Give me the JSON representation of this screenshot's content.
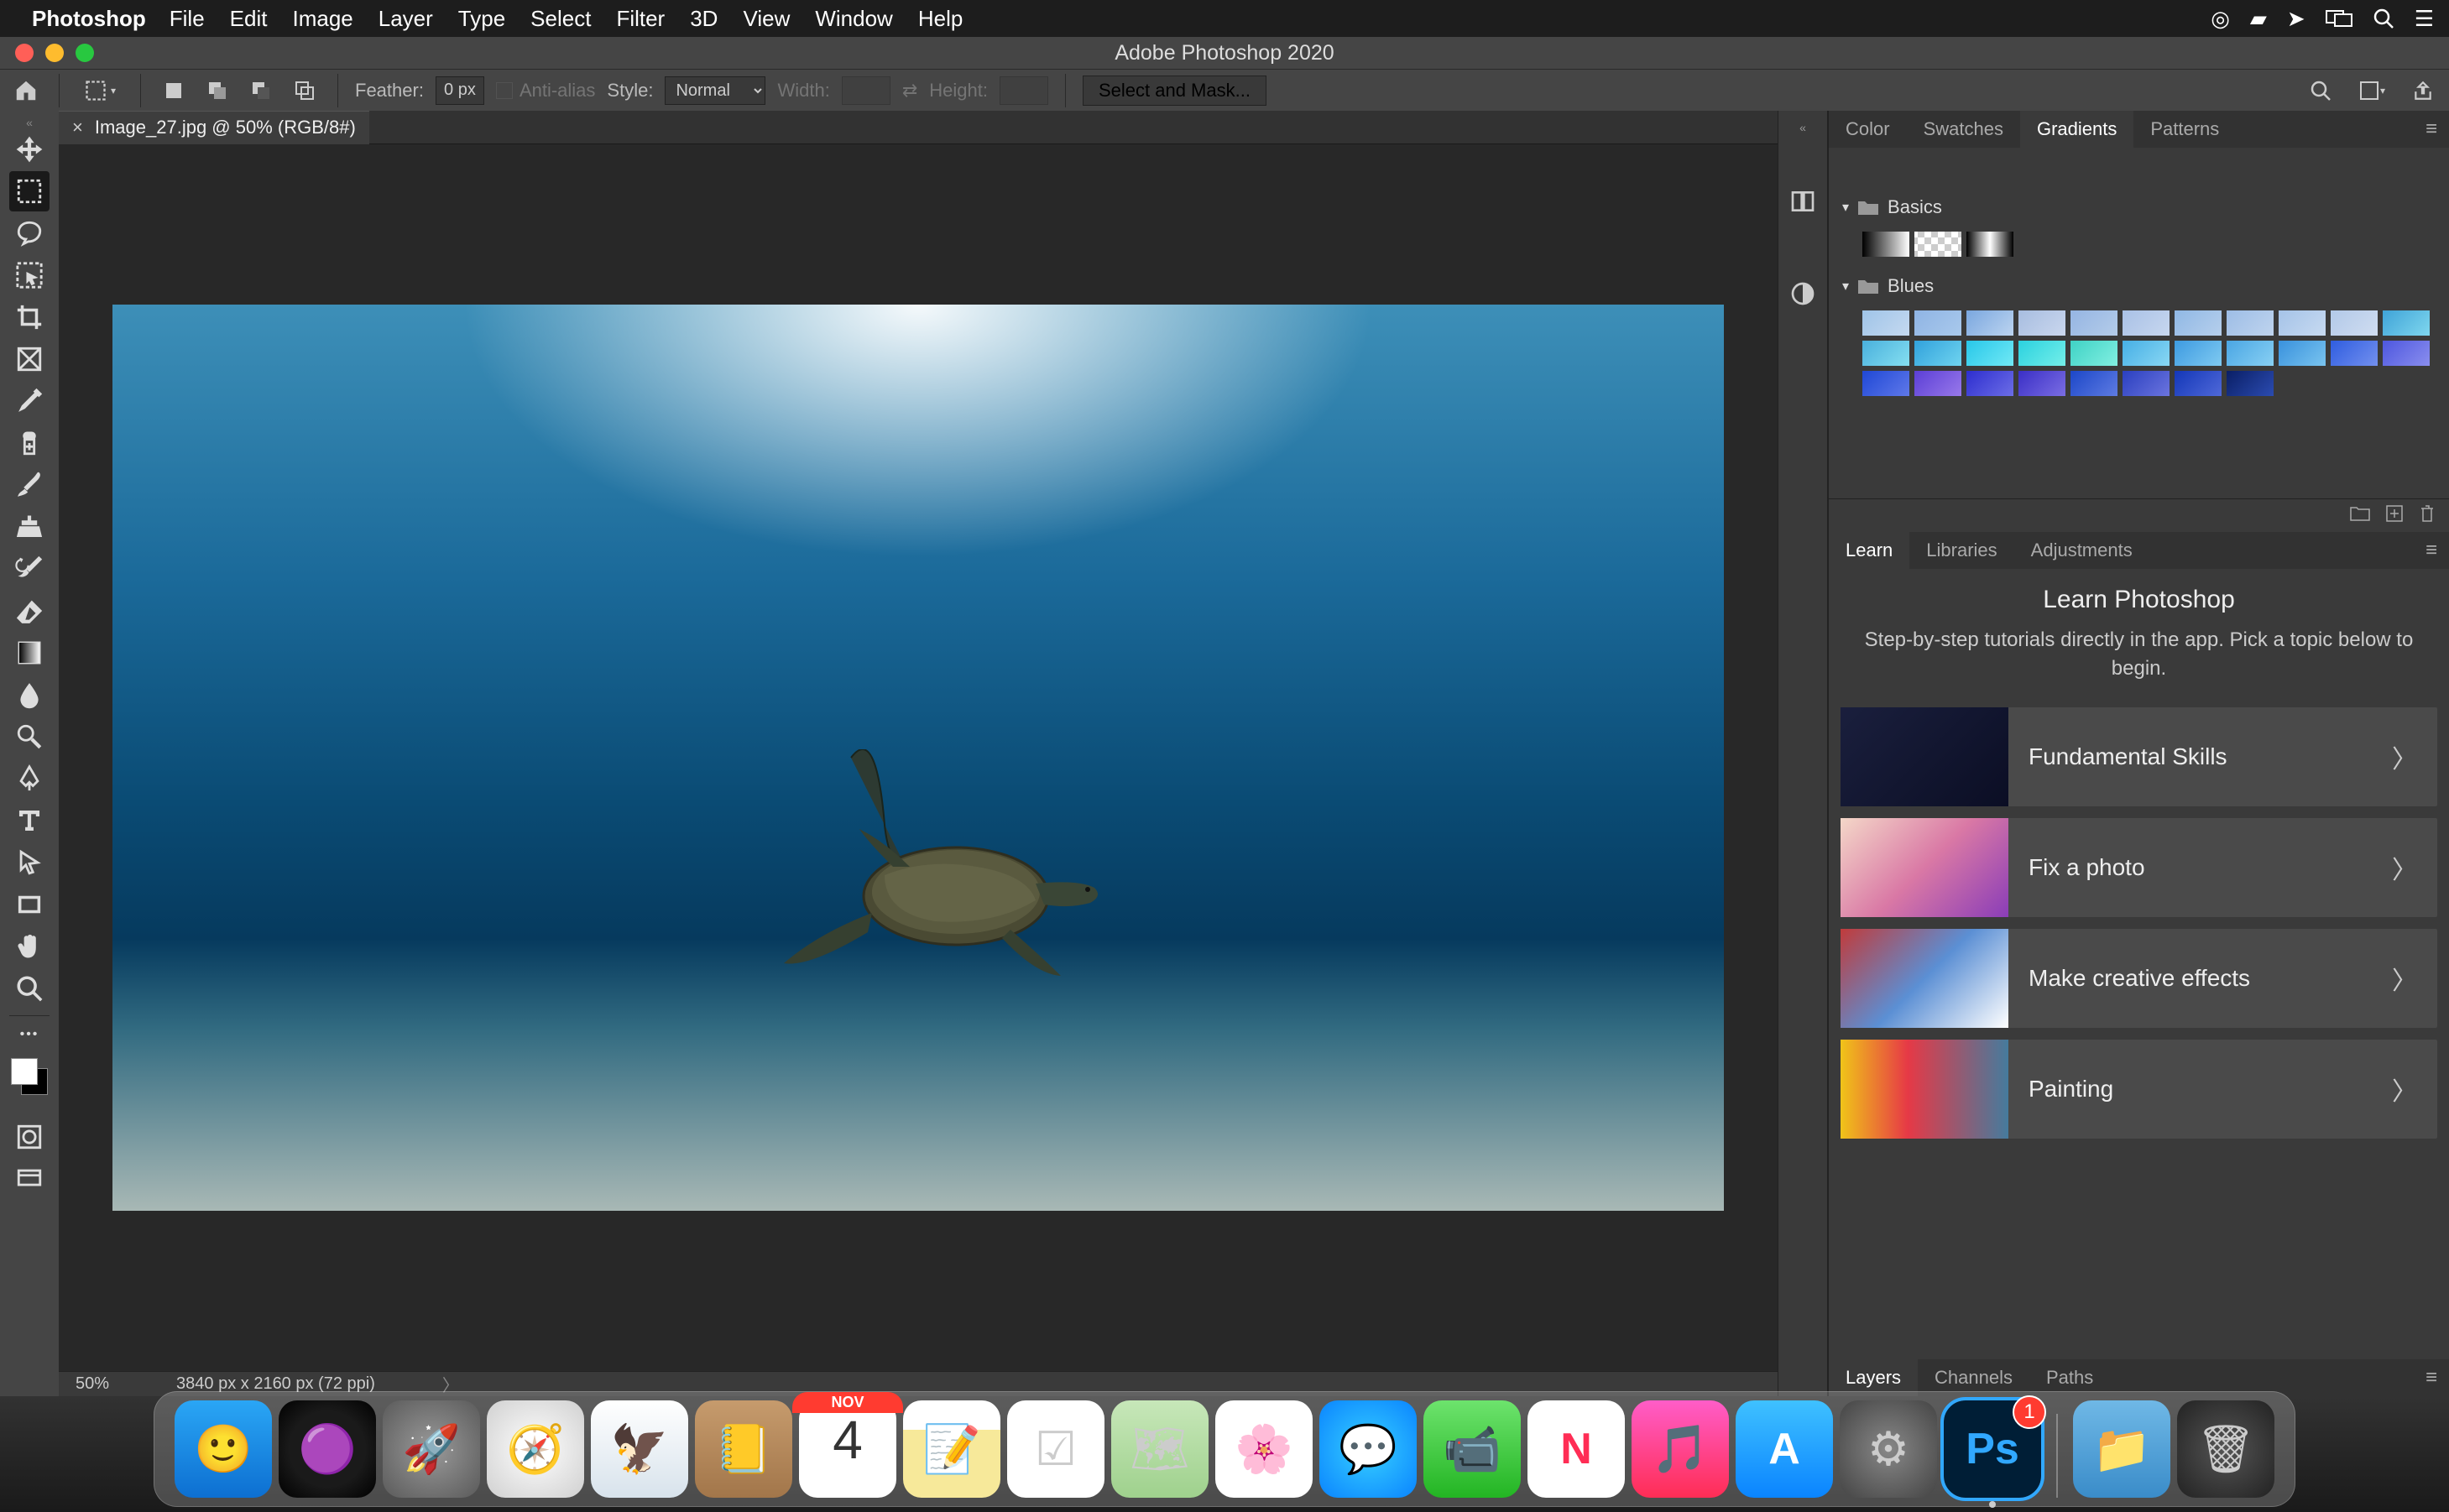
{
  "menubar": {
    "app": "Photoshop",
    "items": [
      "File",
      "Edit",
      "Image",
      "Layer",
      "Type",
      "Select",
      "Filter",
      "3D",
      "View",
      "Window",
      "Help"
    ]
  },
  "titlebar": {
    "title": "Adobe Photoshop 2020"
  },
  "optionsbar": {
    "feather_label": "Feather:",
    "feather_value": "0 px",
    "antialias_label": "Anti-alias",
    "style_label": "Style:",
    "style_value": "Normal",
    "width_label": "Width:",
    "height_label": "Height:",
    "select_mask": "Select and Mask..."
  },
  "document": {
    "tab_title": "Image_27.jpg @ 50% (RGB/8#)",
    "zoom": "50%",
    "dimensions": "3840 px x 2160 px (72 ppi)"
  },
  "toolbar": {
    "tools": [
      {
        "name": "move-tool"
      },
      {
        "name": "rectangular-marquee-tool",
        "active": true
      },
      {
        "name": "lasso-tool"
      },
      {
        "name": "object-selection-tool"
      },
      {
        "name": "crop-tool"
      },
      {
        "name": "frame-tool"
      },
      {
        "name": "eyedropper-tool"
      },
      {
        "name": "spot-healing-tool"
      },
      {
        "name": "brush-tool"
      },
      {
        "name": "clone-stamp-tool"
      },
      {
        "name": "history-brush-tool"
      },
      {
        "name": "eraser-tool"
      },
      {
        "name": "gradient-tool"
      },
      {
        "name": "blur-tool"
      },
      {
        "name": "dodge-tool"
      },
      {
        "name": "pen-tool"
      },
      {
        "name": "type-tool"
      },
      {
        "name": "path-selection-tool"
      },
      {
        "name": "rectangle-tool"
      },
      {
        "name": "hand-tool"
      },
      {
        "name": "zoom-tool"
      }
    ],
    "extra": [
      {
        "name": "edit-toolbar"
      },
      {
        "name": "quick-mask"
      },
      {
        "name": "screen-mode"
      }
    ]
  },
  "panels": {
    "group1_tabs": [
      "Color",
      "Swatches",
      "Gradients",
      "Patterns"
    ],
    "group1_active": "Gradients",
    "gradients": {
      "folders": [
        {
          "name": "Basics",
          "swatches": [
            "linear-gradient(90deg,#000,#fff)",
            "repeating-conic-gradient(#ccc 0 25%, #fff 0 50%) 50%/16px 16px, linear-gradient(90deg,#000,transparent)",
            "linear-gradient(90deg,#000,#fff,#000)"
          ]
        },
        {
          "name": "Blues",
          "swatches": [
            "linear-gradient(135deg,#9fc4e8,#c5d9f0)",
            "linear-gradient(135deg,#8fb4e4,#a9c9ec)",
            "linear-gradient(135deg,#7aa7df,#bcd4f0)",
            "linear-gradient(135deg,#a7bde0,#cad7ee)",
            "linear-gradient(135deg,#95b5e3,#b4cce9)",
            "linear-gradient(135deg,#a9c1e6,#c7d7ef)",
            "linear-gradient(135deg,#90b8e5,#b6cfec)",
            "linear-gradient(135deg,#9dbde6,#bfd4ee)",
            "linear-gradient(135deg,#a5c3e8,#c7daf1)",
            "linear-gradient(135deg,#b2c9e8,#d0ddf1)",
            "linear-gradient(135deg,#3fa3d8,#7fd7ee)",
            "linear-gradient(135deg,#49b0dd,#85dff0)",
            "linear-gradient(135deg,#31a1dc,#6fd4ef)",
            "linear-gradient(135deg,#28c7e9,#71e9f5)",
            "linear-gradient(135deg,#2bd1df,#74efe9)",
            "linear-gradient(135deg,#3fd2c5,#82efe1)",
            "linear-gradient(135deg,#46afe6,#89d7f3)",
            "linear-gradient(135deg,#3d9ae1,#7fcaf1)",
            "linear-gradient(135deg,#4aa6e4,#88d0f3)",
            "linear-gradient(135deg,#3991dd,#79c4ef)",
            "linear-gradient(135deg,#2f5de0,#7390ee)",
            "linear-gradient(135deg,#4d57df,#8a8eee)",
            "linear-gradient(135deg,#1f48d6,#5f78e9)",
            "linear-gradient(135deg,#5b3fd6,#9878ea)",
            "linear-gradient(135deg,#2d2ecf,#6c6de6)",
            "linear-gradient(135deg,#3a2fc6,#7a6de3)",
            "linear-gradient(135deg,#1c47c8,#5e7be2)",
            "linear-gradient(135deg,#2a40c0,#6b74de)",
            "linear-gradient(135deg,#1337b8,#4f68d8)",
            "linear-gradient(135deg,#0a1f66,#2b4bb0)"
          ]
        }
      ]
    },
    "group2_tabs": [
      "Learn",
      "Libraries",
      "Adjustments"
    ],
    "group2_active": "Learn",
    "learn": {
      "title": "Learn Photoshop",
      "subtitle": "Step-by-step tutorials directly in the app. Pick a topic below to begin.",
      "items": [
        {
          "label": "Fundamental Skills",
          "thumb": "linear-gradient(135deg,#1a1f3d,#0b0e24)"
        },
        {
          "label": "Fix a photo",
          "thumb": "linear-gradient(135deg,#f4d7c8,#d978a5,#8a3db8)"
        },
        {
          "label": "Make creative effects",
          "thumb": "linear-gradient(135deg,#c13b3b,#5b8fd4,#ffffff)"
        },
        {
          "label": "Painting",
          "thumb": "linear-gradient(90deg,#f0c419,#e63946 40%,#457b9d)"
        }
      ]
    },
    "group3_tabs": [
      "Layers",
      "Channels",
      "Paths"
    ],
    "group3_active": "Layers"
  },
  "dock": {
    "items": [
      {
        "name": "finder",
        "bg": "linear-gradient(#2aa6f5,#0d6fd1)",
        "emoji": "🙂"
      },
      {
        "name": "siri",
        "bg": "radial-gradient(circle,#1a1a1a 55%,#000)",
        "emoji": "🟣"
      },
      {
        "name": "launchpad",
        "bg": "radial-gradient(circle,#9a9a9a,#5a5a5a)",
        "emoji": "🚀"
      },
      {
        "name": "safari",
        "bg": "radial-gradient(circle,#fff,#d0d0d0)",
        "emoji": "🧭"
      },
      {
        "name": "mail",
        "bg": "linear-gradient(#fff,#d8e3ec)",
        "emoji": "🦅"
      },
      {
        "name": "contacts",
        "bg": "linear-gradient(#c69b6d,#a2764a)",
        "emoji": "📒"
      },
      {
        "name": "calendar",
        "bg": "#fff",
        "emoji": "",
        "text_top": "NOV",
        "text_main": "4"
      },
      {
        "name": "notes",
        "bg": "linear-gradient(#fff 30%,#f7e99a 30%)",
        "emoji": "📝"
      },
      {
        "name": "reminders",
        "bg": "#fff",
        "emoji": "☑"
      },
      {
        "name": "maps",
        "bg": "linear-gradient(#c7e7b9,#9fd18d)",
        "emoji": "🗺"
      },
      {
        "name": "photos",
        "bg": "#fff",
        "emoji": "🌸"
      },
      {
        "name": "messages",
        "bg": "radial-gradient(circle,#37d0ff,#0a84ff)",
        "emoji": "💬"
      },
      {
        "name": "facetime",
        "bg": "linear-gradient(#6de36d,#23b523)",
        "emoji": "📹"
      },
      {
        "name": "news",
        "bg": "#fff",
        "emoji": "N",
        "text_color": "#ff2d55"
      },
      {
        "name": "music",
        "bg": "linear-gradient(#ff5dc8,#ff2d55)",
        "emoji": "🎵"
      },
      {
        "name": "appstore",
        "bg": "linear-gradient(#3fc1ff,#0a84ff)",
        "emoji": "A",
        "text_color": "#fff"
      },
      {
        "name": "settings",
        "bg": "radial-gradient(circle,#888,#444)",
        "emoji": "⚙"
      },
      {
        "name": "photoshop",
        "bg": "#001e36",
        "emoji": "Ps",
        "text_color": "#31a8ff",
        "badge": "1",
        "active": true
      }
    ],
    "right": [
      {
        "name": "downloads",
        "bg": "linear-gradient(#6fb8e6,#3a8cc9)",
        "emoji": "📁"
      },
      {
        "name": "trash",
        "bg": "radial-gradient(circle,#555,#222)",
        "emoji": "🗑"
      }
    ]
  }
}
